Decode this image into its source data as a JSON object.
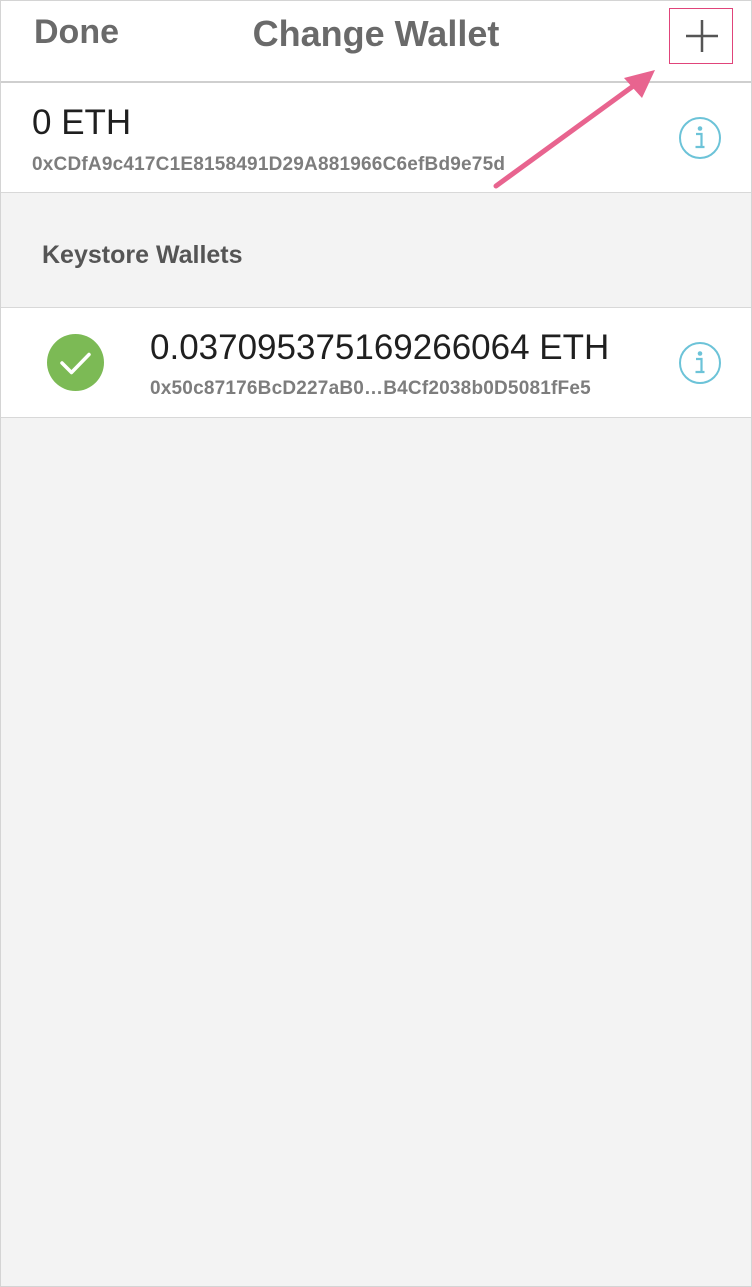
{
  "navbar": {
    "done_label": "Done",
    "title": "Change Wallet",
    "add_icon": "plus-icon"
  },
  "ledger_wallet": {
    "balance": "0 ETH",
    "address": "0xCDfA9c417C1E8158491D29A881966C6efBd9e75d",
    "info_icon": "info-icon"
  },
  "keystore_section": {
    "header": "Keystore Wallets",
    "wallets": [
      {
        "balance": "0.037095375169266064 ETH",
        "address": "0x50c87176BcD227aB0…B4Cf2038b0D5081fFe5",
        "selected": true,
        "status_icon": "checkmark-icon",
        "info_icon": "info-icon"
      }
    ]
  },
  "colors": {
    "accent_info": "#6cc3d8",
    "selected_green": "#7cba55",
    "annotation_pink": "#e8648f",
    "background": "#f3f3f3"
  }
}
